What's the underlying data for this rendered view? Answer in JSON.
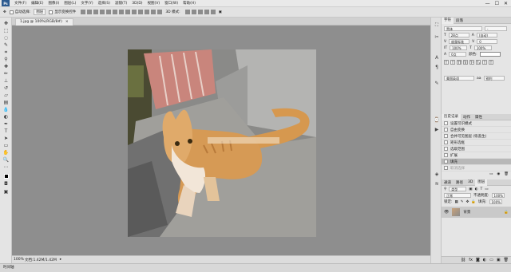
{
  "menubar": {
    "logo": "Ps",
    "items": [
      "文件(F)",
      "编辑(E)",
      "图像(I)",
      "图层(L)",
      "文字(Y)",
      "选择(S)",
      "滤镜(T)",
      "3D(D)",
      "视图(V)",
      "窗口(W)",
      "帮助(H)"
    ],
    "min": "—",
    "max": "☐",
    "close": "✕"
  },
  "options": {
    "auto_select_label": "自动选择:",
    "auto_select_value": "图层",
    "show_transform": "显示变换控件",
    "mode3d": "3D 模式:",
    "workspace_icon": "▣"
  },
  "document": {
    "tab_label": "1.jpg @ 100%(RGB/8#)",
    "close": "×"
  },
  "statusbar": {
    "zoom": "100%",
    "doc_info": "文档:1.42M/1.42M"
  },
  "timeline": {
    "label": "时间轴"
  },
  "character": {
    "tabs": [
      "字符",
      "段落"
    ],
    "font_family": "黑体",
    "font_style": "-",
    "size": "28点",
    "leading": "(自动)",
    "tracking": "0",
    "kerning": "度量标准",
    "scale_v": "100%",
    "scale_h": "100%",
    "baseline": "0点",
    "color_label": "颜色:",
    "styles": [
      "T",
      "T",
      "TT",
      "Tr",
      "T¹",
      "T₁",
      "T",
      "T"
    ],
    "lang": "美国英语",
    "aa": "锐利"
  },
  "history": {
    "tabs": [
      "历史记录",
      "动作",
      "属性"
    ],
    "items": [
      {
        "label": "设置可识模式",
        "state": "normal"
      },
      {
        "label": "自由变换",
        "state": "normal"
      },
      {
        "label": "合并可见图层 (恢盖生)",
        "state": "normal"
      },
      {
        "label": "矩形选框",
        "state": "normal"
      },
      {
        "label": "选取范围",
        "state": "normal"
      },
      {
        "label": "扩展",
        "state": "normal"
      },
      {
        "label": "填充",
        "state": "selected"
      },
      {
        "label": "取消选择",
        "state": "ghost"
      }
    ]
  },
  "layers": {
    "tabs": [
      "通道",
      "路径",
      "3D",
      "图层"
    ],
    "kind_label": "类型",
    "blend_mode": "正常",
    "opacity_label": "不透明度:",
    "opacity": "100%",
    "lock_label": "锁定:",
    "fill_label": "填充:",
    "fill": "100%",
    "layer_name": "背景",
    "lock_icon": "🔒"
  }
}
